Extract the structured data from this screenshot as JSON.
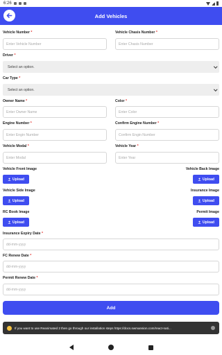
{
  "status_bar": {
    "time": "6:26"
  },
  "header": {
    "title": "Add Vehicles"
  },
  "fields": {
    "vehicle_number": {
      "label": "Vehicle Number",
      "required": "*",
      "placeholder": "Enter Vehicle Number"
    },
    "vehicle_chasis_number": {
      "label": "Vehicle Chasis Number",
      "required": "*",
      "placeholder": "Enter Chasis Number"
    },
    "driver": {
      "label": "Driver",
      "required": "*",
      "value": "Select an option."
    },
    "car_type": {
      "label": "Car Type",
      "required": "*",
      "value": "Select an option."
    },
    "owner_name": {
      "label": "Owner Name",
      "required": "*",
      "placeholder": "Enter Owner Name"
    },
    "color": {
      "label": "Color",
      "required": "*",
      "placeholder": "Enter Color"
    },
    "engine_number": {
      "label": "Engine Number",
      "required": "*",
      "placeholder": "Enter Engin Number"
    },
    "confirm_engine_number": {
      "label": "Confirm Engine Number",
      "required": "*",
      "placeholder": "Confirm Engin Number"
    },
    "vehicle_modal": {
      "label": "Vehicle Modal",
      "required": "*",
      "placeholder": "Enter Modal"
    },
    "vehicle_year": {
      "label": "Vehicle Year",
      "required": "*",
      "placeholder": "Enter Year"
    },
    "insurance_expiry_date": {
      "label": "Insurance Expiry Date",
      "required": "*",
      "placeholder": "dd-mm-yyyy"
    },
    "fc_renew_date": {
      "label": "FC Renew Date",
      "required": "*",
      "placeholder": "dd-mm-yyyy"
    },
    "permit_renew_date": {
      "label": "Permit Renew Date",
      "required": "*",
      "placeholder": "dd-mm-yyyy"
    }
  },
  "images": {
    "upload_label": "Upload",
    "vehicle_front": "Vehicle Front Image",
    "vehicle_back": "Vehicle Back Image",
    "vehicle_side": "Vehicle Side Image",
    "insurance": "Insurance Image",
    "rc_book": "RC Book Image",
    "permit": "Permit Image"
  },
  "submit": {
    "label": "Add"
  },
  "toast": {
    "message": "If you want to use Reanimated 2 then go through our installation steps https://docs.swmansion.com/react-nati..."
  },
  "icons": {
    "back": "arrow-left-icon",
    "upload": "upload-icon",
    "dropdown": "chevron-down-icon"
  },
  "colors": {
    "primary": "#3f4df0",
    "required": "#e53935"
  }
}
